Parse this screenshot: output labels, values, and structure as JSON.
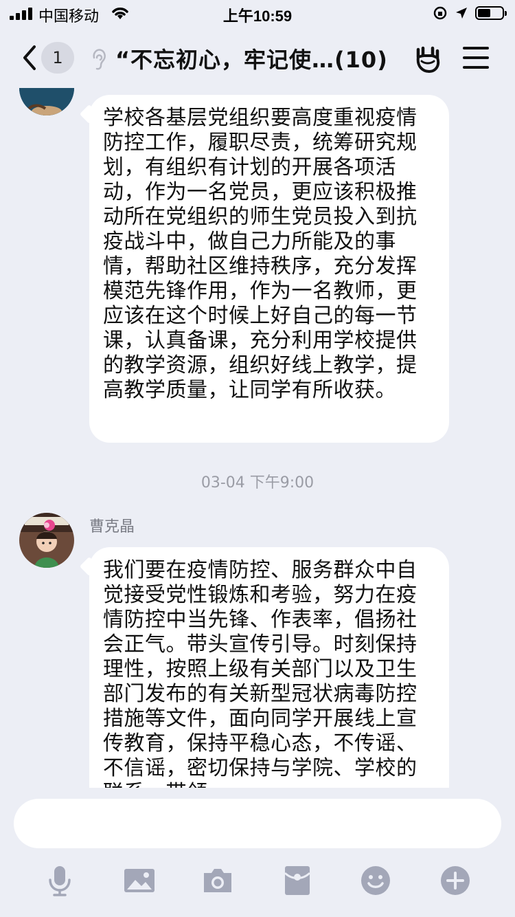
{
  "status_bar": {
    "carrier": "中国移动",
    "time": "上午10:59"
  },
  "nav": {
    "unread_count": "1",
    "title": "“不忘初心，牢记使…(10)"
  },
  "messages": [
    {
      "text": "学校各基层党组织要高度重视疫情防控工作，履职尽责，统筹研究规划，有组织有计划的开展各项活动，作为一名党员，更应该积极推动所在党组织的师生党员投入到抗疫战斗中，做自己力所能及的事情，帮助社区维持秩序，充分发挥模范先锋作用，作为一名教师，更应该在这个时候上好自己的每一节课，认真备课，充分利用学校提供的教学资源，组织好线上教学，提高教学质量，让同学有所收获。"
    },
    {
      "timestamp": "03-04 下午9:00",
      "sender": "曹克晶",
      "text": "我们要在疫情防控、服务群众中自觉接受党性锻炼和考验，努力在疫情防控中当先锋、作表率，倡扬社会正气。带头宣传引导。时刻保持理性，按照上级有关部门以及卫生部门发布的有关新型冠状病毒防控措施等文件，面向同学开展线上宣传教育，保持平稳心态，不传谣、不信谣，密切保持与学院、学校的联系，带领"
    }
  ],
  "input": {
    "placeholder": ""
  },
  "toolbar": {
    "icons": [
      "microphone-icon",
      "image-icon",
      "camera-icon",
      "red-packet-icon",
      "emoji-icon",
      "plus-icon"
    ],
    "icon_color": "#a3a7b8"
  }
}
